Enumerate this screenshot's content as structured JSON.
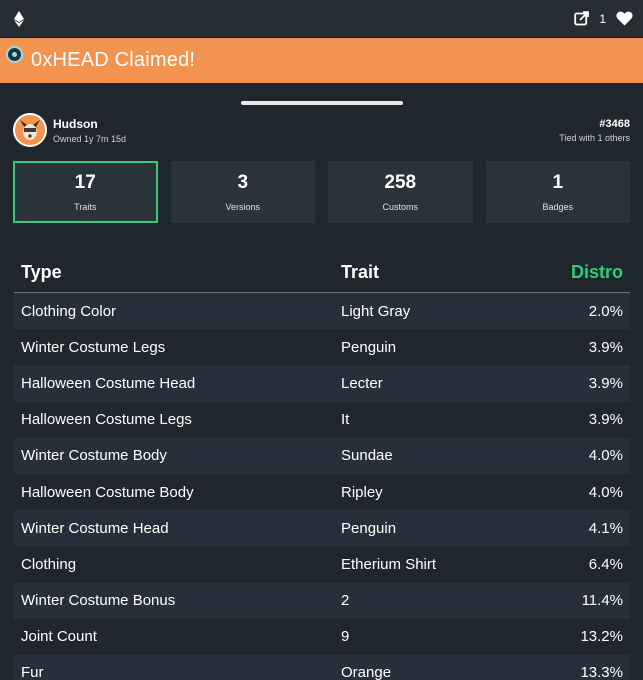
{
  "topbar": {
    "chain_icon": "ethereum-icon",
    "share_icon": "external-link-icon",
    "like_count": "1",
    "like_icon": "heart-icon"
  },
  "banner": {
    "icon": "claim-badge-icon",
    "text": "0xHEAD Claimed!",
    "color": "#f0944f"
  },
  "owner": {
    "name": "Hudson",
    "owned": "Owned 1y 7m 15d",
    "token_id": "#3468",
    "tied": "Tied with 1 others"
  },
  "stats": [
    {
      "value": "17",
      "label": "Traits",
      "active": true
    },
    {
      "value": "3",
      "label": "Versions",
      "active": false
    },
    {
      "value": "258",
      "label": "Customs",
      "active": false
    },
    {
      "value": "1",
      "label": "Badges",
      "active": false
    }
  ],
  "table": {
    "headers": {
      "type": "Type",
      "trait": "Trait",
      "distro": "Distro"
    },
    "rows": [
      {
        "type": "Clothing Color",
        "trait": "Light Gray",
        "distro": "2.0%"
      },
      {
        "type": "Winter Costume Legs",
        "trait": "Penguin",
        "distro": "3.9%"
      },
      {
        "type": "Halloween Costume Head",
        "trait": "Lecter",
        "distro": "3.9%"
      },
      {
        "type": "Halloween Costume Legs",
        "trait": "It",
        "distro": "3.9%"
      },
      {
        "type": "Winter Costume Body",
        "trait": "Sundae",
        "distro": "4.0%"
      },
      {
        "type": "Halloween Costume Body",
        "trait": "Ripley",
        "distro": "4.0%"
      },
      {
        "type": "Winter Costume Head",
        "trait": "Penguin",
        "distro": "4.1%"
      },
      {
        "type": "Clothing",
        "trait": "Etherium Shirt",
        "distro": "6.4%"
      },
      {
        "type": "Winter Costume Bonus",
        "trait": "2",
        "distro": "11.4%"
      },
      {
        "type": "Joint Count",
        "trait": "9",
        "distro": "13.2%"
      },
      {
        "type": "Fur",
        "trait": "Orange",
        "distro": "13.3%"
      }
    ]
  },
  "colors": {
    "accent_green": "#2fcf76",
    "active_border": "#3cc878",
    "background": "#1f262e"
  }
}
